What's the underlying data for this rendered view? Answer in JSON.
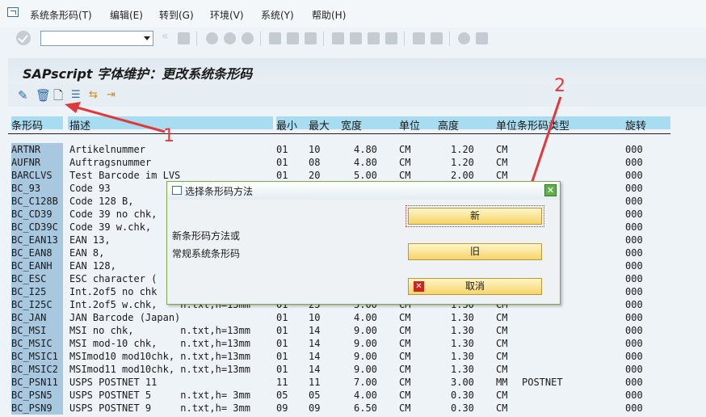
{
  "menu": [
    "系统条形码(T)",
    "编辑(E)",
    "转到(G)",
    "环境(V)",
    "系统(Y)",
    "帮助(H)"
  ],
  "toolbar": {
    "command_value": ""
  },
  "title": "SAPscript 字体维护：更改系统条形码",
  "columns": {
    "code": "条形码",
    "desc": "描述",
    "min": "最小",
    "max": "最大",
    "width": "宽度",
    "unit": "单位",
    "height": "高度",
    "unit_type": "单位条形码类型",
    "rotation": "旋转"
  },
  "rows": [
    {
      "code": "ARTNR",
      "desc": "Artikelnummer",
      "min": "01",
      "max": "10",
      "width": "4.80",
      "unit": "CM",
      "height": "1.20",
      "unit2": "CM",
      "type": "",
      "rot": "000"
    },
    {
      "code": "AUFNR",
      "desc": "Auftragsnummer",
      "min": "01",
      "max": "08",
      "width": "4.80",
      "unit": "CM",
      "height": "1.20",
      "unit2": "CM",
      "type": "",
      "rot": "000"
    },
    {
      "code": "BARCLVS",
      "desc": "Test Barcode im LVS",
      "min": "01",
      "max": "20",
      "width": "5.00",
      "unit": "CM",
      "height": "2.00",
      "unit2": "CM",
      "type": "",
      "rot": "000"
    },
    {
      "code": "BC_93",
      "desc": "Code 93",
      "min": "",
      "max": "",
      "width": "",
      "unit": "",
      "height": "",
      "unit2": "",
      "type": "",
      "rot": "000"
    },
    {
      "code": "BC_C128B",
      "desc": "Code 128 B,",
      "min": "",
      "max": "",
      "width": "",
      "unit": "",
      "height": "",
      "unit2": "",
      "type": "",
      "rot": "000"
    },
    {
      "code": "BC_CD39",
      "desc": "Code 39 no chk,",
      "min": "",
      "max": "",
      "width": "",
      "unit": "",
      "height": "",
      "unit2": "",
      "type": "",
      "rot": "000"
    },
    {
      "code": "BC_CD39C",
      "desc": "Code 39 w.chk,",
      "min": "",
      "max": "",
      "width": "",
      "unit": "",
      "height": "",
      "unit2": "",
      "type": "",
      "rot": "000"
    },
    {
      "code": "BC_EAN13",
      "desc": "EAN 13,",
      "min": "",
      "max": "",
      "width": "",
      "unit": "",
      "height": "",
      "unit2": "",
      "type": "",
      "rot": "000"
    },
    {
      "code": "BC_EAN8",
      "desc": "EAN 8,",
      "min": "",
      "max": "",
      "width": "",
      "unit": "",
      "height": "",
      "unit2": "",
      "type": "",
      "rot": "000"
    },
    {
      "code": "BC_EANH",
      "desc": "EAN 128,",
      "min": "",
      "max": "",
      "width": "",
      "unit": "",
      "height": "",
      "unit2": "",
      "type": "",
      "rot": "000"
    },
    {
      "code": "BC_ESC",
      "desc": "ESC character (",
      "min": "",
      "max": "",
      "width": "",
      "unit": "",
      "height": "",
      "unit2": "",
      "type": "",
      "rot": "000"
    },
    {
      "code": "BC_I25",
      "desc": "Int.2of5 no chk",
      "min": "",
      "max": "",
      "width": "",
      "unit": "",
      "height": "",
      "unit2": "",
      "type": "",
      "rot": "000"
    },
    {
      "code": "BC_I25C",
      "desc": "Int.2of5 w.chk,    n.txt,h=13mm",
      "min": "01",
      "max": "25",
      "width": "5.00",
      "unit": "CM",
      "height": "1.30",
      "unit2": "CM",
      "type": "",
      "rot": "000"
    },
    {
      "code": "BC_JAN",
      "desc": "JAN Barcode (Japan)",
      "min": "01",
      "max": "10",
      "width": "4.00",
      "unit": "CM",
      "height": "1.30",
      "unit2": "CM",
      "type": "",
      "rot": "000"
    },
    {
      "code": "BC_MSI",
      "desc": "MSI no chk,        n.txt,h=13mm",
      "min": "01",
      "max": "14",
      "width": "9.00",
      "unit": "CM",
      "height": "1.30",
      "unit2": "CM",
      "type": "",
      "rot": "000"
    },
    {
      "code": "BC_MSIC",
      "desc": "MSI mod-10 chk,    n.txt,h=13mm",
      "min": "01",
      "max": "14",
      "width": "9.00",
      "unit": "CM",
      "height": "1.30",
      "unit2": "CM",
      "type": "",
      "rot": "000"
    },
    {
      "code": "BC_MSIC1",
      "desc": "MSImod10 mod10chk, n.txt,h=13mm",
      "min": "01",
      "max": "14",
      "width": "9.00",
      "unit": "CM",
      "height": "1.30",
      "unit2": "CM",
      "type": "",
      "rot": "000"
    },
    {
      "code": "BC_MSIC2",
      "desc": "MSImod11 mod10chk, n.txt,h=13mm",
      "min": "01",
      "max": "14",
      "width": "9.00",
      "unit": "CM",
      "height": "1.30",
      "unit2": "CM",
      "type": "",
      "rot": "000"
    },
    {
      "code": "BC_PSN11",
      "desc": "USPS POSTNET 11",
      "min": "11",
      "max": "11",
      "width": "7.00",
      "unit": "CM",
      "height": "3.00",
      "unit2": "MM",
      "type": "POSTNET",
      "rot": "000"
    },
    {
      "code": "BC_PSN5",
      "desc": "USPS POSTNET 5     n.txt,h= 3mm",
      "min": "05",
      "max": "05",
      "width": "4.00",
      "unit": "CM",
      "height": "0.30",
      "unit2": "CM",
      "type": "",
      "rot": "000"
    },
    {
      "code": "BC_PSN9",
      "desc": "USPS POSTNET 9     n.txt,h= 3mm",
      "min": "09",
      "max": "09",
      "width": "6.50",
      "unit": "CM",
      "height": "0.30",
      "unit2": "CM",
      "type": "",
      "rot": "000"
    }
  ],
  "dialog": {
    "title": "选择条形码方法",
    "text1": "新条形码方法或",
    "text2": "常规系统条形码",
    "btn_new": "新",
    "btn_old": "旧",
    "btn_cancel": "取消"
  },
  "annotations": {
    "one": "1",
    "two": "2"
  },
  "colors": {
    "annotation": "#e0393b",
    "header_bg": "#a8dcf0",
    "button": "#f6d36a"
  }
}
